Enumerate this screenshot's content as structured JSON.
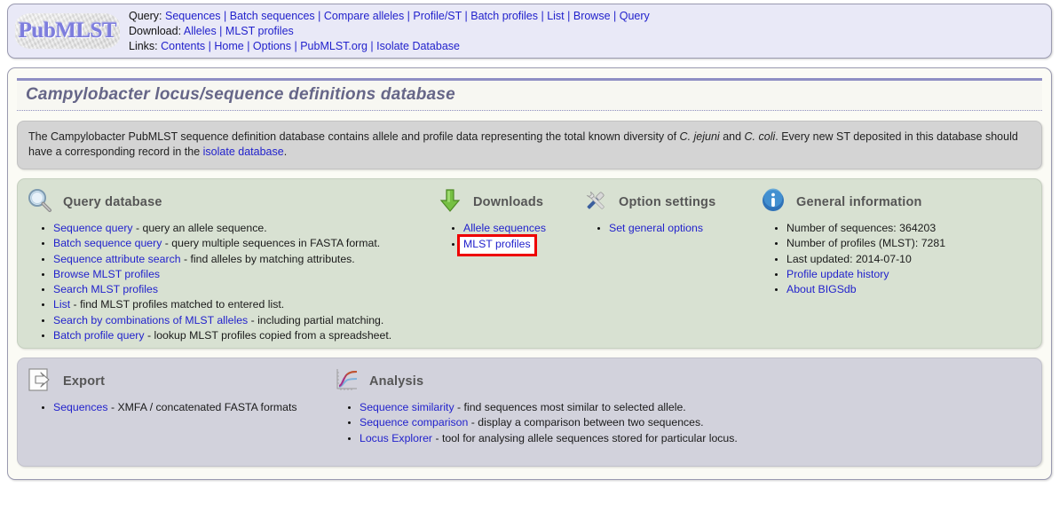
{
  "header": {
    "logo_text": "PubMLST",
    "rows": [
      {
        "label": "Query:",
        "links": [
          "Sequences",
          "Batch sequences",
          "Compare alleles",
          "Profile/ST",
          "Batch profiles",
          "List",
          "Browse",
          "Query"
        ]
      },
      {
        "label": "Download:",
        "links": [
          "Alleles",
          "MLST profiles"
        ]
      },
      {
        "label": "Links:",
        "links": [
          "Contents",
          "Home",
          "Options",
          "PubMLST.org",
          "Isolate Database"
        ]
      }
    ]
  },
  "page": {
    "title": "Campylobacter locus/sequence definitions database",
    "description_parts": [
      {
        "t": "The Campylobacter PubMLST sequence definition database contains allele and profile data representing the total known diversity of ",
        "s": "text"
      },
      {
        "t": "C. jejuni",
        "s": "italic"
      },
      {
        "t": " and ",
        "s": "text"
      },
      {
        "t": "C. coli",
        "s": "italic"
      },
      {
        "t": ". Every new ST deposited in this database should have a corresponding record in the ",
        "s": "text"
      },
      {
        "t": "isolate database",
        "s": "link"
      },
      {
        "t": ".",
        "s": "text"
      }
    ]
  },
  "sections": {
    "query_database": {
      "title": "Query database",
      "icon": "magnifier-icon",
      "items": [
        {
          "link": "Sequence query",
          "desc": " - query an allele sequence."
        },
        {
          "link": "Batch sequence query",
          "desc": " - query multiple sequences in FASTA format."
        },
        {
          "link": "Sequence attribute search",
          "desc": " - find alleles by matching attributes."
        },
        {
          "link": "Browse MLST profiles",
          "desc": ""
        },
        {
          "link": "Search MLST profiles",
          "desc": ""
        },
        {
          "link": "List",
          "desc": " - find MLST profiles matched to entered list."
        },
        {
          "link": "Search by combinations of MLST alleles",
          "desc": " - including partial matching."
        },
        {
          "link": "Batch profile query",
          "desc": " - lookup MLST profiles copied from a spreadsheet."
        }
      ]
    },
    "downloads": {
      "title": "Downloads",
      "icon": "green-down-arrow-icon",
      "items": [
        {
          "link": "Allele sequences",
          "desc": "",
          "highlighted": false
        },
        {
          "link": "MLST profiles",
          "desc": "",
          "highlighted": true
        }
      ]
    },
    "option_settings": {
      "title": "Option settings",
      "icon": "tools-icon",
      "items": [
        {
          "link": "Set general options",
          "desc": ""
        }
      ]
    },
    "general_information": {
      "title": "General information",
      "icon": "info-icon",
      "items": [
        {
          "link": "",
          "desc": "Number of sequences: 364203"
        },
        {
          "link": "",
          "desc": "Number of profiles (MLST): 7281"
        },
        {
          "link": "",
          "desc": "Last updated: 2014-07-10"
        },
        {
          "link": "Profile update history",
          "desc": ""
        },
        {
          "link": "About BIGSdb",
          "desc": ""
        }
      ]
    },
    "export": {
      "title": "Export",
      "icon": "export-document-icon",
      "items": [
        {
          "link": "Sequences",
          "desc": " - XMFA / concatenated FASTA formats"
        }
      ]
    },
    "analysis": {
      "title": "Analysis",
      "icon": "line-chart-icon",
      "items": [
        {
          "link": "Sequence similarity",
          "desc": " - find sequences most similar to selected allele."
        },
        {
          "link": "Sequence comparison",
          "desc": " - display a comparison between two sequences."
        },
        {
          "link": "Locus Explorer",
          "desc": " - tool for analysing allele sequences stored for particular locus."
        }
      ]
    }
  },
  "colors": {
    "link": "#2222cc",
    "header_bg": "#e9e9f7",
    "green_panel": "#d8e1d2",
    "gray_panel": "#d2d2dc",
    "desc_panel": "#d4d4d4",
    "title": "#666688",
    "highlight_box": "#ee0000"
  }
}
